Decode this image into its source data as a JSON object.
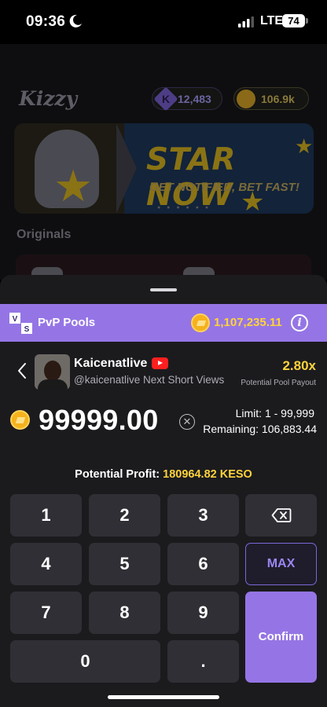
{
  "status_bar": {
    "time": "09:36",
    "network": "LTE",
    "battery": "74"
  },
  "background_app": {
    "logo": "Kizzy",
    "balances": {
      "k_balance": "12,483",
      "coin_balance": "106.9k"
    },
    "banner": {
      "title": "STAR NOW",
      "subtitle": "GET NOTIFIED, BET FAST!"
    },
    "section_title": "Originals"
  },
  "sheet": {
    "header": {
      "icon_label": "V S",
      "title": "PvP Pools",
      "pool_total": "1,107,235.11",
      "info_label": "i"
    },
    "market": {
      "streamer": "Kaicenatlive",
      "description": "@kaicenatlive Next Short Views",
      "multiplier": "2.80x",
      "payout_label": "Potential Pool Payout"
    },
    "bet": {
      "amount": "99999.00",
      "limit": "Limit: 1 - 99,999",
      "remaining": "Remaining: 106,883.44"
    },
    "profit": {
      "label": "Potential Profit:",
      "value": "180964.82 KESO"
    },
    "keypad": {
      "digits": [
        "1",
        "2",
        "3",
        "4",
        "5",
        "6",
        "7",
        "8",
        "9",
        "0",
        "."
      ],
      "max_label": "MAX",
      "confirm_label": "Confirm"
    }
  },
  "colors": {
    "accent_purple": "#9575e5",
    "gold": "#ffd33a",
    "sheet_bg": "#1b1b1e",
    "key_bg": "#2f2f35"
  }
}
